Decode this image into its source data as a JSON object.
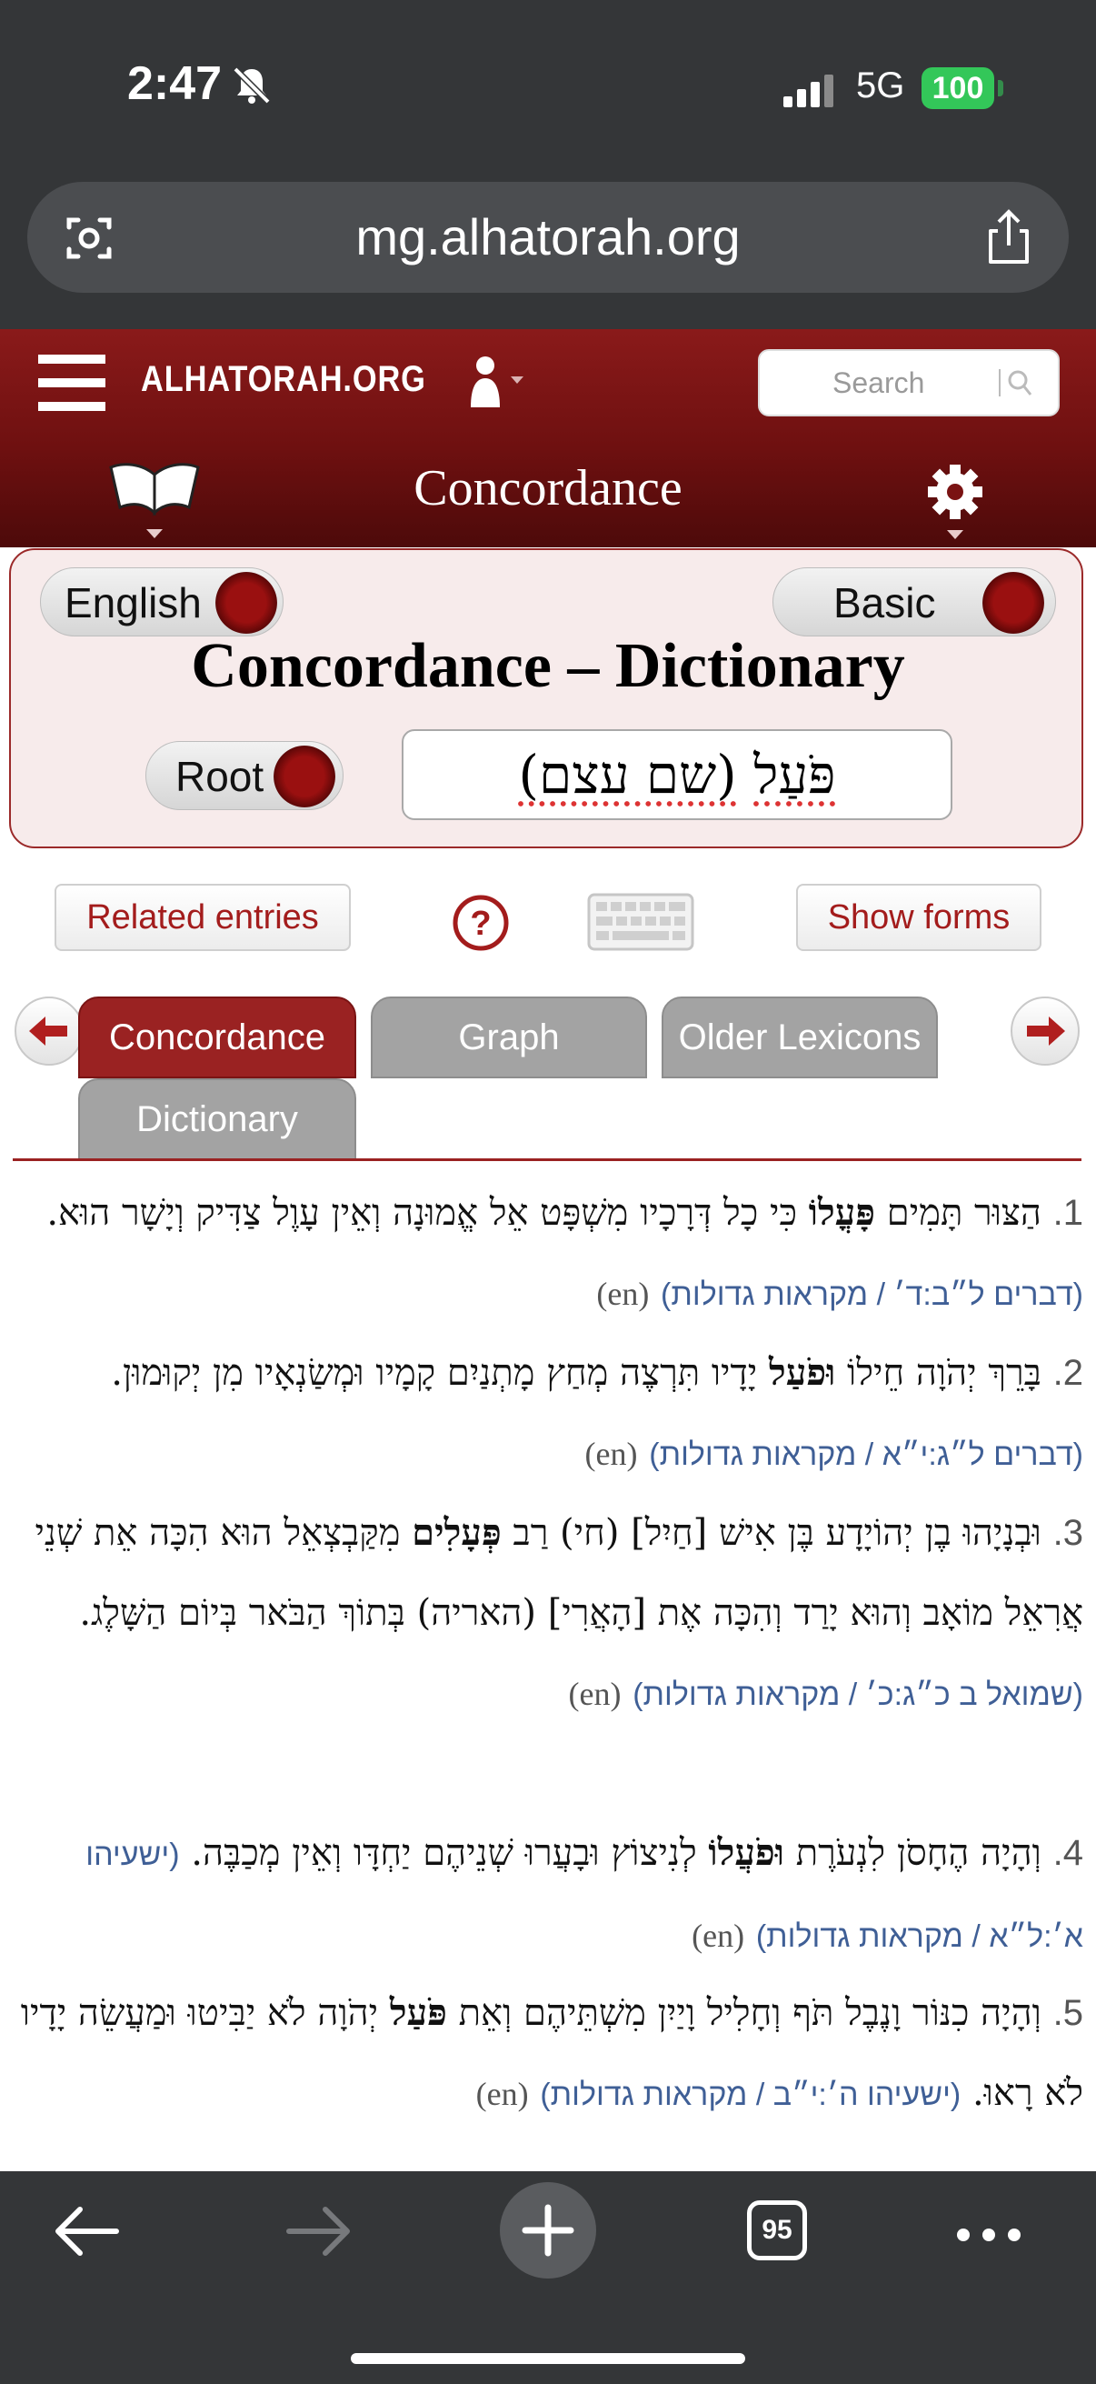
{
  "status_bar": {
    "time": "2:47",
    "network": "5G",
    "battery": "100"
  },
  "browser": {
    "url": "mg.alhatorah.org",
    "open_tabs": "95"
  },
  "site": {
    "name": "ALHATORAH.ORG",
    "search_placeholder": "Search",
    "page_heading": "Concordance"
  },
  "panel": {
    "language_toggle": "English",
    "level_toggle": "Basic",
    "title": "Concordance – Dictionary",
    "mode_toggle": "Root",
    "root_word": "פֹּעַל",
    "root_type": "(שם עצם)"
  },
  "actions": {
    "related": "Related entries",
    "help": "?",
    "show_forms": "Show forms"
  },
  "tabs": [
    "Concordance",
    "Graph",
    "Older Lexicons",
    "Dictionary"
  ],
  "results": [
    {
      "num": "1.",
      "pre": "הַצּוּר תָּמִים ",
      "bold": "פָּעֳלוֹ",
      "post": " כִּי כָל דְּרָכָיו מִשְׁפָּט אֵל אֱמוּנָה וְאֵין עָוֶל צַדִּיק וְיָשָׁר הוּא. ",
      "source": "(דברים ל״ב:ד׳ / מקראות גדולות)",
      "en": "(en)"
    },
    {
      "num": "2.",
      "pre": "בָּרֵךְ יְהֹוָה חֵילוֹ ",
      "bold": "וּפֹעַל",
      "post": " יָדָיו תִּרְצֶה מְחַץ מָתְנַיִם קָמָיו וּמְשַׂנְאָיו מִן יְקוּמוּן. ",
      "source": "(דברים ל״ג:י״א / מקראות גדולות)",
      "en": "(en)"
    },
    {
      "num": "3.",
      "pre": "וּבְנָיָהוּ בֶן יְהוֹיָדָע בֶּן אִישׁ [חַיִל] (חי) רַב ",
      "bold": "פְּעָלִים",
      "post": " מִקַּבְצְאֵל הוּא הִכָּה אֵת שְׁנֵי אֲרִאֵל מוֹאָב וְהוּא יָרַד וְהִכָּה אֶת [הָאֲרִי] (האריה) בְּתוֹךְ הַבֹּאר בְּיוֹם הַשָּׁלֶג. ",
      "source": "(שמואל ב כ״ג:כ׳ / מקראות גדולות)",
      "en": "(en)"
    },
    {
      "num": "4.",
      "pre": "וְהָיָה הֶחָסֹן לִנְעֹרֶת ",
      "bold": "וּפֹעֲלוֹ",
      "post": " לְנִיצוֹץ וּבָעֲרוּ שְׁנֵיהֶם יַחְדָּו וְאֵין מְכַבֶּה. ",
      "source": "(ישעיהו א׳:ל״א / מקראות גדולות)",
      "en": "(en)"
    },
    {
      "num": "5.",
      "pre": "וְהָיָה כִנּוֹר וָנֶבֶל תֹּף וְחָלִיל וָיַיִן מִשְׁתֵּיהֶם וְאֵת ",
      "bold": "פֹּעַל",
      "post": " יְהֹוָה לֹא יַבִּיטוּ וּמַעֲשֵׂה יָדָיו לֹא רָאוּ. ",
      "source": "(ישעיהו ה׳:י״ב / מקראות גדולות)",
      "en": "(en)"
    }
  ]
}
